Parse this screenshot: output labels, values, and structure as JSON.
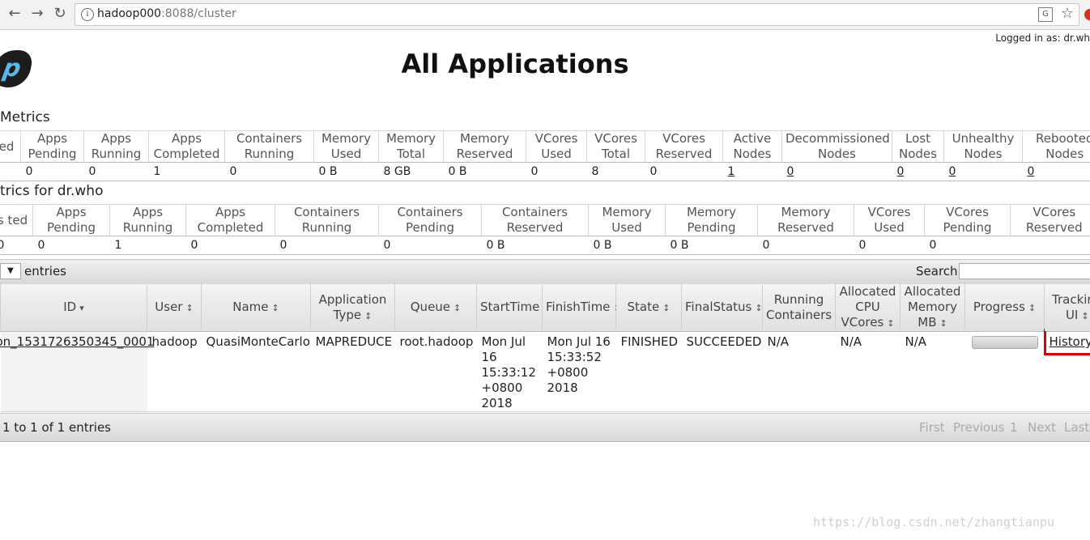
{
  "browser": {
    "url_host": "hadoop000",
    "url_path": ":8088/cluster",
    "back_icon": "back-arrow-icon",
    "forward_icon": "forward-arrow-icon",
    "reload_icon": "reload-icon"
  },
  "header": {
    "logged_in": "Logged in as: dr.wh",
    "title": "All Applications"
  },
  "cluster_metrics": {
    "title": "Metrics",
    "headers": [
      "ed",
      "Apps Pending",
      "Apps Running",
      "Apps Completed",
      "Containers Running",
      "Memory Used",
      "Memory Total",
      "Memory Reserved",
      "VCores Used",
      "VCores Total",
      "VCores Reserved",
      "Active Nodes",
      "Decommissioned Nodes",
      "Lost Nodes",
      "Unhealthy Nodes",
      "Rebooted Nodes"
    ],
    "values": [
      "",
      "0",
      "0",
      "1",
      "0",
      "0 B",
      "8 GB",
      "0 B",
      "0",
      "8",
      "0",
      "1",
      "0",
      "0",
      "0",
      "0"
    ]
  },
  "user_metrics": {
    "title": "trics for dr.who",
    "headers": [
      "s ted",
      "Apps Pending",
      "Apps Running",
      "Apps Completed",
      "Containers Running",
      "Containers Pending",
      "Containers Reserved",
      "Memory Used",
      "Memory Pending",
      "Memory Reserved",
      "VCores Used",
      "VCores Pending",
      "VCores Reserved"
    ],
    "values": [
      "0",
      "0",
      "1",
      "0",
      "0",
      "0",
      "0 B",
      "0 B",
      "0 B",
      "0",
      "0",
      "0",
      ""
    ]
  },
  "datatable": {
    "entries_label": "entries",
    "search_label": "Search:",
    "info": "1 to 1 of 1 entries",
    "pager": [
      "First",
      "Previous",
      "1",
      "Next",
      "Last"
    ]
  },
  "apps_table": {
    "headers": [
      "ID",
      "User",
      "Name",
      "Application Type",
      "Queue",
      "StartTime",
      "FinishTime",
      "State",
      "FinalStatus",
      "Running Containers",
      "Allocated CPU VCores",
      "Allocated Memory MB",
      "Progress",
      "Tracking UI"
    ],
    "row": {
      "id": "on_1531726350345_0001",
      "user": "hadoop",
      "name": "QuasiMonteCarlo",
      "type": "MAPREDUCE",
      "queue": "root.hadoop",
      "start": "Mon Jul 16 15:33:12 +0800 2018",
      "finish": "Mon Jul 16 15:33:52 +0800 2018",
      "state": "FINISHED",
      "final_status": "SUCCEEDED",
      "running_containers": "N/A",
      "alloc_vcores": "N/A",
      "alloc_memory": "N/A",
      "progress": 1.0,
      "tracking": "History"
    }
  },
  "watermark": "https://blog.csdn.net/zhangtianpu"
}
